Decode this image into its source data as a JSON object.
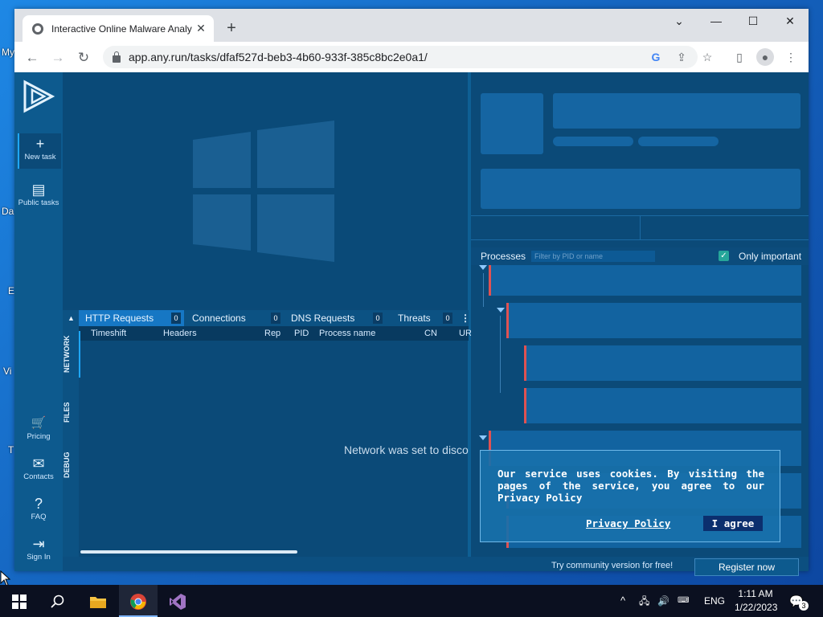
{
  "desktop": {
    "labels": [
      "My",
      "Da",
      "E",
      "Vi",
      "T"
    ]
  },
  "browser": {
    "tab_title": "Interactive Online Malware Analy",
    "tab_close": "✕",
    "new_tab": "+",
    "url": "app.any.run/tasks/dfaf527d-beb3-4b60-933f-385c8bc2e0a1/",
    "window_controls": {
      "chevron": "⌄",
      "minimize": "—",
      "maximize": "☐",
      "close": "✕"
    },
    "nav": {
      "back": "←",
      "forward": "→",
      "reload": "↻"
    },
    "toolbar_icons": {
      "google": "G",
      "share": "⇪",
      "bookmark": "☆",
      "sidepanel": "▯",
      "profile": "●",
      "menu": "⋮"
    }
  },
  "sidebar": {
    "items": [
      {
        "label": "New task",
        "icon": "+"
      },
      {
        "label": "Public tasks",
        "icon": "▤"
      },
      {
        "label": "Pricing",
        "icon": "🛒"
      },
      {
        "label": "Contacts",
        "icon": "✉"
      },
      {
        "label": "FAQ",
        "icon": "?"
      },
      {
        "label": "Sign In",
        "icon": "⇥"
      }
    ]
  },
  "network_panel": {
    "tabs": [
      {
        "label": "HTTP Requests",
        "count": "0"
      },
      {
        "label": "Connections",
        "count": "0"
      },
      {
        "label": "DNS Requests",
        "count": "0"
      },
      {
        "label": "Threats",
        "count": "0"
      }
    ],
    "more": "⋮",
    "columns": [
      "Timeshift",
      "Headers",
      "Rep",
      "PID",
      "Process name",
      "CN",
      "UR"
    ],
    "side_tabs": [
      "NETWORK",
      "FILES",
      "DEBUG"
    ],
    "message": "Network was set to disco",
    "collapse": "▲"
  },
  "processes": {
    "title": "Processes",
    "filter_placeholder": "Filter by PID or name",
    "only_important_label": "Only important",
    "only_important_checked": true
  },
  "cookie_banner": {
    "message": "Our service uses cookies. By visiting the pages of the service, you agree to our Privacy Policy",
    "privacy_link": "Privacy Policy",
    "agree_button": "I agree"
  },
  "footer": {
    "try_text": "Try community version for free!",
    "register_button": "Register now"
  },
  "taskbar": {
    "time": "1:11 AM",
    "date": "1/22/2023",
    "language": "ENG",
    "notifications": "3"
  },
  "colors": {
    "accent": "#1ea7ff",
    "process_marker": "#e05252",
    "checkbox": "#26a69a"
  }
}
